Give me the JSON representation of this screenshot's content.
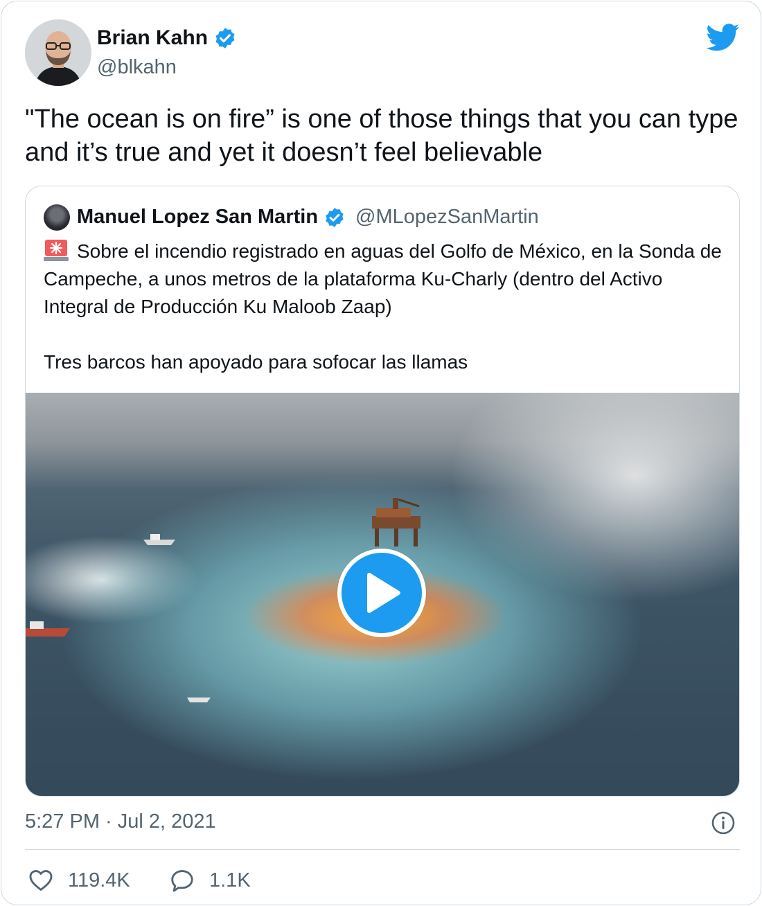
{
  "author": {
    "name": "Brian Kahn",
    "handle": "@blkahn",
    "verified": true,
    "avatar_icon": "person-avatar"
  },
  "tweet": {
    "text": "\"The ocean is on fire” is one of those things that you can type and it’s true and yet it doesn’t feel believable",
    "timestamp": "5:27 PM · Jul 2, 2021"
  },
  "quoted_tweet": {
    "author_name": "Manuel Lopez San Martin",
    "author_handle": "@MLopezSanMartin",
    "verified": true,
    "line1": "Sobre el incendio registrado en aguas del Golfo de México, en la Sonda de Campeche, a unos metros de la plataforma Ku-Charly (dentro del Activo Integral de Producción Ku Maloob Zaap)",
    "line2": "Tres barcos han apoyado para sofocar las llamas",
    "emoji_icon": "siren-icon",
    "media": {
      "type": "video",
      "icon": "play-icon"
    }
  },
  "stats": {
    "likes": "119.4K",
    "replies": "1.1K"
  },
  "colors": {
    "brand": "#1d9bf0",
    "text_primary": "#0f1419",
    "text_secondary": "#536471",
    "border": "#cfd9de"
  }
}
